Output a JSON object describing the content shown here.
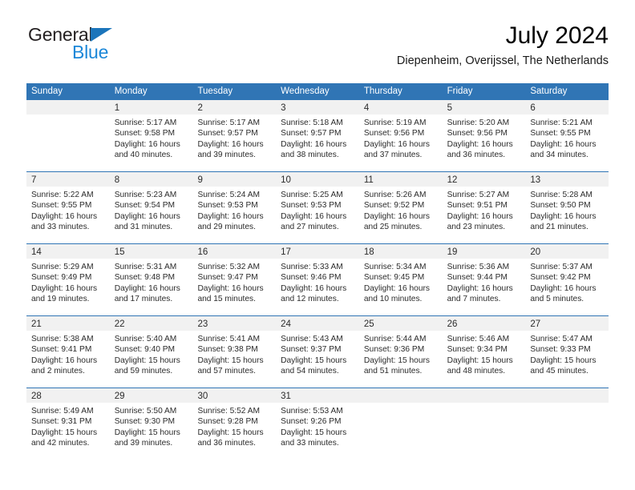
{
  "logo": {
    "word_top": "General",
    "word_bottom": "Blue",
    "triangle_icon": "triangle-icon",
    "color_dark": "#231f20",
    "color_blue": "#1b87d8"
  },
  "header": {
    "title": "July 2024",
    "subtitle": "Diepenheim, Overijssel, The Netherlands"
  },
  "theme": {
    "header_bg": "#3075b5",
    "daynum_bg": "#f1f1f1",
    "grid_line": "#3075b5",
    "text": "#2b2b2b"
  },
  "calendar": {
    "weekdays": [
      "Sunday",
      "Monday",
      "Tuesday",
      "Wednesday",
      "Thursday",
      "Friday",
      "Saturday"
    ],
    "weeks": [
      [
        {
          "day": "",
          "lines": []
        },
        {
          "day": "1",
          "lines": [
            "Sunrise: 5:17 AM",
            "Sunset: 9:58 PM",
            "Daylight: 16 hours",
            "and 40 minutes."
          ]
        },
        {
          "day": "2",
          "lines": [
            "Sunrise: 5:17 AM",
            "Sunset: 9:57 PM",
            "Daylight: 16 hours",
            "and 39 minutes."
          ]
        },
        {
          "day": "3",
          "lines": [
            "Sunrise: 5:18 AM",
            "Sunset: 9:57 PM",
            "Daylight: 16 hours",
            "and 38 minutes."
          ]
        },
        {
          "day": "4",
          "lines": [
            "Sunrise: 5:19 AM",
            "Sunset: 9:56 PM",
            "Daylight: 16 hours",
            "and 37 minutes."
          ]
        },
        {
          "day": "5",
          "lines": [
            "Sunrise: 5:20 AM",
            "Sunset: 9:56 PM",
            "Daylight: 16 hours",
            "and 36 minutes."
          ]
        },
        {
          "day": "6",
          "lines": [
            "Sunrise: 5:21 AM",
            "Sunset: 9:55 PM",
            "Daylight: 16 hours",
            "and 34 minutes."
          ]
        }
      ],
      [
        {
          "day": "7",
          "lines": [
            "Sunrise: 5:22 AM",
            "Sunset: 9:55 PM",
            "Daylight: 16 hours",
            "and 33 minutes."
          ]
        },
        {
          "day": "8",
          "lines": [
            "Sunrise: 5:23 AM",
            "Sunset: 9:54 PM",
            "Daylight: 16 hours",
            "and 31 minutes."
          ]
        },
        {
          "day": "9",
          "lines": [
            "Sunrise: 5:24 AM",
            "Sunset: 9:53 PM",
            "Daylight: 16 hours",
            "and 29 minutes."
          ]
        },
        {
          "day": "10",
          "lines": [
            "Sunrise: 5:25 AM",
            "Sunset: 9:53 PM",
            "Daylight: 16 hours",
            "and 27 minutes."
          ]
        },
        {
          "day": "11",
          "lines": [
            "Sunrise: 5:26 AM",
            "Sunset: 9:52 PM",
            "Daylight: 16 hours",
            "and 25 minutes."
          ]
        },
        {
          "day": "12",
          "lines": [
            "Sunrise: 5:27 AM",
            "Sunset: 9:51 PM",
            "Daylight: 16 hours",
            "and 23 minutes."
          ]
        },
        {
          "day": "13",
          "lines": [
            "Sunrise: 5:28 AM",
            "Sunset: 9:50 PM",
            "Daylight: 16 hours",
            "and 21 minutes."
          ]
        }
      ],
      [
        {
          "day": "14",
          "lines": [
            "Sunrise: 5:29 AM",
            "Sunset: 9:49 PM",
            "Daylight: 16 hours",
            "and 19 minutes."
          ]
        },
        {
          "day": "15",
          "lines": [
            "Sunrise: 5:31 AM",
            "Sunset: 9:48 PM",
            "Daylight: 16 hours",
            "and 17 minutes."
          ]
        },
        {
          "day": "16",
          "lines": [
            "Sunrise: 5:32 AM",
            "Sunset: 9:47 PM",
            "Daylight: 16 hours",
            "and 15 minutes."
          ]
        },
        {
          "day": "17",
          "lines": [
            "Sunrise: 5:33 AM",
            "Sunset: 9:46 PM",
            "Daylight: 16 hours",
            "and 12 minutes."
          ]
        },
        {
          "day": "18",
          "lines": [
            "Sunrise: 5:34 AM",
            "Sunset: 9:45 PM",
            "Daylight: 16 hours",
            "and 10 minutes."
          ]
        },
        {
          "day": "19",
          "lines": [
            "Sunrise: 5:36 AM",
            "Sunset: 9:44 PM",
            "Daylight: 16 hours",
            "and 7 minutes."
          ]
        },
        {
          "day": "20",
          "lines": [
            "Sunrise: 5:37 AM",
            "Sunset: 9:42 PM",
            "Daylight: 16 hours",
            "and 5 minutes."
          ]
        }
      ],
      [
        {
          "day": "21",
          "lines": [
            "Sunrise: 5:38 AM",
            "Sunset: 9:41 PM",
            "Daylight: 16 hours",
            "and 2 minutes."
          ]
        },
        {
          "day": "22",
          "lines": [
            "Sunrise: 5:40 AM",
            "Sunset: 9:40 PM",
            "Daylight: 15 hours",
            "and 59 minutes."
          ]
        },
        {
          "day": "23",
          "lines": [
            "Sunrise: 5:41 AM",
            "Sunset: 9:38 PM",
            "Daylight: 15 hours",
            "and 57 minutes."
          ]
        },
        {
          "day": "24",
          "lines": [
            "Sunrise: 5:43 AM",
            "Sunset: 9:37 PM",
            "Daylight: 15 hours",
            "and 54 minutes."
          ]
        },
        {
          "day": "25",
          "lines": [
            "Sunrise: 5:44 AM",
            "Sunset: 9:36 PM",
            "Daylight: 15 hours",
            "and 51 minutes."
          ]
        },
        {
          "day": "26",
          "lines": [
            "Sunrise: 5:46 AM",
            "Sunset: 9:34 PM",
            "Daylight: 15 hours",
            "and 48 minutes."
          ]
        },
        {
          "day": "27",
          "lines": [
            "Sunrise: 5:47 AM",
            "Sunset: 9:33 PM",
            "Daylight: 15 hours",
            "and 45 minutes."
          ]
        }
      ],
      [
        {
          "day": "28",
          "lines": [
            "Sunrise: 5:49 AM",
            "Sunset: 9:31 PM",
            "Daylight: 15 hours",
            "and 42 minutes."
          ]
        },
        {
          "day": "29",
          "lines": [
            "Sunrise: 5:50 AM",
            "Sunset: 9:30 PM",
            "Daylight: 15 hours",
            "and 39 minutes."
          ]
        },
        {
          "day": "30",
          "lines": [
            "Sunrise: 5:52 AM",
            "Sunset: 9:28 PM",
            "Daylight: 15 hours",
            "and 36 minutes."
          ]
        },
        {
          "day": "31",
          "lines": [
            "Sunrise: 5:53 AM",
            "Sunset: 9:26 PM",
            "Daylight: 15 hours",
            "and 33 minutes."
          ]
        },
        {
          "day": "",
          "lines": []
        },
        {
          "day": "",
          "lines": []
        },
        {
          "day": "",
          "lines": []
        }
      ]
    ]
  }
}
